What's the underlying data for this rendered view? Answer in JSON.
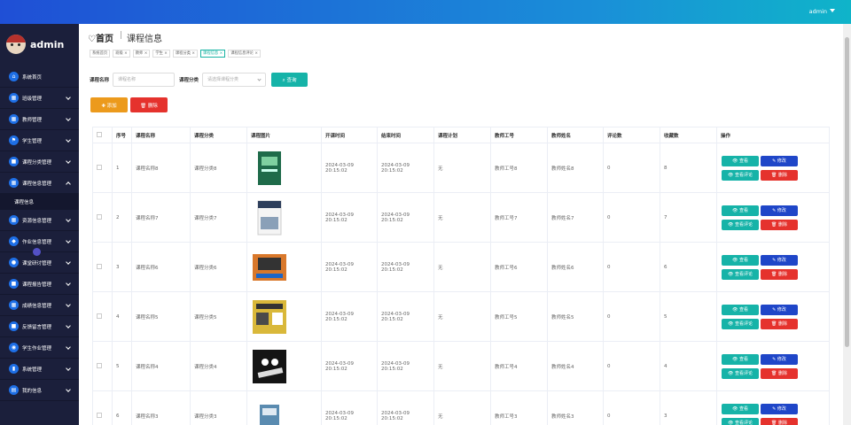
{
  "header": {
    "user": "admin"
  },
  "brand": {
    "name": "admin"
  },
  "menu": [
    {
      "icon": "home-icon",
      "glyph": "⌂",
      "label": "系统首页",
      "chev": ""
    },
    {
      "icon": "grid-icon",
      "glyph": "▦",
      "label": "班级管理",
      "chev": "down"
    },
    {
      "icon": "grid-icon",
      "glyph": "▦",
      "label": "教师管理",
      "chev": "down"
    },
    {
      "icon": "flag-icon",
      "glyph": "⚑",
      "label": "学生管理",
      "chev": "down"
    },
    {
      "icon": "box-icon",
      "glyph": "■",
      "label": "课程分类管理",
      "chev": "down"
    },
    {
      "icon": "grid-icon",
      "glyph": "▦",
      "label": "课程信息管理",
      "chev": "up",
      "sub": "课程信息"
    },
    {
      "icon": "grid-icon",
      "glyph": "▦",
      "label": "资源信息管理",
      "chev": "down"
    },
    {
      "icon": "shield-icon",
      "glyph": "◆",
      "label": "作业信息管理",
      "chev": "down"
    },
    {
      "icon": "person-icon",
      "glyph": "●",
      "label": "课堂研讨管理",
      "chev": "down"
    },
    {
      "icon": "box-icon",
      "glyph": "■",
      "label": "课程报告管理",
      "chev": "down"
    },
    {
      "icon": "grid-icon",
      "glyph": "▦",
      "label": "成绩信息管理",
      "chev": "down"
    },
    {
      "icon": "box-icon",
      "glyph": "■",
      "label": "反馈留言管理",
      "chev": "down"
    },
    {
      "icon": "pin-icon",
      "glyph": "◉",
      "label": "学生作业管理",
      "chev": "down"
    },
    {
      "icon": "bars-icon",
      "glyph": "▮",
      "label": "系统管理",
      "chev": "down"
    },
    {
      "icon": "card-icon",
      "glyph": "▤",
      "label": "我的信息",
      "chev": "down"
    }
  ],
  "breadcrumb": {
    "home": "♡首页",
    "current": "课程信息"
  },
  "tags": [
    {
      "label": "系统首页",
      "active": false
    },
    {
      "label": "班级 ×",
      "active": false
    },
    {
      "label": "教师 ×",
      "active": false
    },
    {
      "label": "学生 ×",
      "active": false
    },
    {
      "label": "课程分类 ×",
      "active": false
    },
    {
      "label": "课程信息 ×",
      "active": true
    },
    {
      "label": "课程信息评论 ×",
      "active": false
    }
  ],
  "search": {
    "name_label": "课程名称",
    "name_placeholder": "课程名称",
    "cat_label": "课程分类",
    "cat_placeholder": "请选择课程分类",
    "button": "⌕ 查询"
  },
  "actions": {
    "add": "✚ 添加",
    "delete": "🗑 删除"
  },
  "table": {
    "columns": [
      "",
      "序号",
      "课程名称",
      "课程分类",
      "课程图片",
      "开课时间",
      "结束时间",
      "课程计划",
      "教师工号",
      "教师姓名",
      "评论数",
      "收藏数",
      "操作"
    ],
    "rows": [
      {
        "no": "1",
        "name": "课程名称8",
        "cat": "课程分类8",
        "start": "2024-03-09 20:15:02",
        "end": "2024-03-09 20:15:02",
        "plan": "无",
        "tid": "教师工号8",
        "tname": "教师姓名8",
        "comments": "0",
        "fav": "8",
        "cover": "#1f6b4a"
      },
      {
        "no": "2",
        "name": "课程名称7",
        "cat": "课程分类7",
        "start": "2024-03-09 20:15:02",
        "end": "2024-03-09 20:15:02",
        "plan": "无",
        "tid": "教师工号7",
        "tname": "教师姓名7",
        "comments": "0",
        "fav": "7",
        "cover": "#2e3f5c"
      },
      {
        "no": "3",
        "name": "课程名称6",
        "cat": "课程分类6",
        "start": "2024-03-09 20:15:02",
        "end": "2024-03-09 20:15:02",
        "plan": "无",
        "tid": "教师工号6",
        "tname": "教师姓名6",
        "comments": "0",
        "fav": "6",
        "cover": "#d9782b"
      },
      {
        "no": "4",
        "name": "课程名称5",
        "cat": "课程分类5",
        "start": "2024-03-09 20:15:02",
        "end": "2024-03-09 20:15:02",
        "plan": "无",
        "tid": "教师工号5",
        "tname": "教师姓名5",
        "comments": "0",
        "fav": "5",
        "cover": "#d9b83a"
      },
      {
        "no": "5",
        "name": "课程名称4",
        "cat": "课程分类4",
        "start": "2024-03-09 20:15:02",
        "end": "2024-03-09 20:15:02",
        "plan": "无",
        "tid": "教师工号4",
        "tname": "教师姓名4",
        "comments": "0",
        "fav": "4",
        "cover": "#141414"
      },
      {
        "no": "6",
        "name": "课程名称3",
        "cat": "课程分类3",
        "start": "2024-03-09 20:15:02",
        "end": "2024-03-09 20:15:02",
        "plan": "无",
        "tid": "教师工号3",
        "tname": "教师姓名3",
        "comments": "0",
        "fav": "3",
        "cover": "#5a8bb0"
      }
    ],
    "ops": {
      "view": "👁 查看",
      "edit": "✎ 修改",
      "comment": "👁 查看评论",
      "delete": "🗑 删除"
    }
  },
  "colors": {
    "accent": "#16b3a8",
    "primary": "#1f46c8",
    "danger": "#e5322d",
    "warning": "#ec9a1c",
    "sidebar": "#1b1f3b"
  }
}
